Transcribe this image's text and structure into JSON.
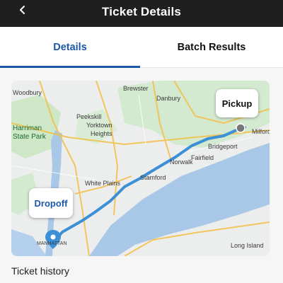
{
  "header": {
    "title": "Ticket Details",
    "back_icon": "chevron-left-icon"
  },
  "tabs": [
    {
      "label": "Details",
      "selected": true
    },
    {
      "label": "Batch Results",
      "selected": false
    }
  ],
  "map": {
    "pickup_label": "Pickup",
    "dropoff_label": "Dropoff",
    "places": {
      "woodbury": "Woodbury",
      "brewster": "Brewster",
      "danbury": "Danbury",
      "peekskill": "Peekskill",
      "yorktown": "Yorktown",
      "heights": "Heights",
      "harriman": "Harriman",
      "state_park": "State Park",
      "bridgeport": "Bridgeport",
      "milford": "Milford",
      "fairfield": "Fairfield",
      "norwalk": "Norwalk",
      "stamford": "Stamford",
      "white_plains": "White Plains",
      "long_island": "Long Island",
      "manhattan": "MANHATTAN"
    },
    "colors": {
      "route": "#3d8fd6",
      "water": "#a9c8e8",
      "land": "#e9ecef",
      "park": "#cde7c7",
      "accent": "#1b58a8"
    }
  },
  "section": {
    "ticket_history": "Ticket history"
  }
}
